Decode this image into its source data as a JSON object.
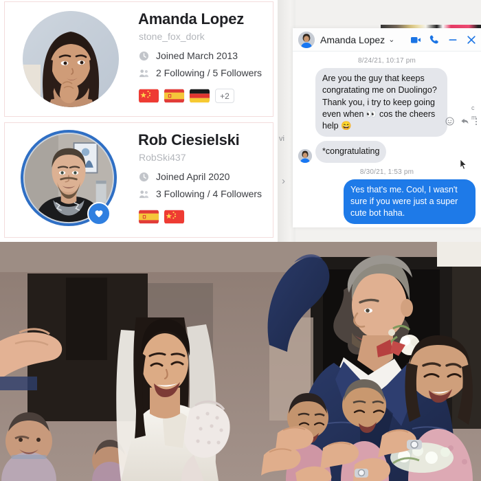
{
  "profiles": {
    "cards": [
      {
        "name": "Amanda Lopez",
        "handle": "stone_fox_dork",
        "joined": "Joined March 2013",
        "follows": "2 Following / 5 Followers",
        "flags": [
          "china",
          "spain",
          "germany"
        ],
        "more_flags": "+2",
        "has_heart_badge": false,
        "avatar_ring": false
      },
      {
        "name": "Rob Ciesielski",
        "handle": "RobSki437",
        "joined": "Joined April 2020",
        "follows": "3 Following / 4 Followers",
        "flags": [
          "spain",
          "china"
        ],
        "more_flags": "",
        "has_heart_badge": true,
        "avatar_ring": true
      }
    ],
    "icons": {
      "clock": "clock-icon",
      "people": "people-icon",
      "heart": "heart-icon"
    },
    "colors": {
      "card_border": "#f3dcdc",
      "name": "#1f2024",
      "handle": "#b3b6bb",
      "meta": "#3b3d42",
      "ring": "#2f6fc4",
      "badge": "#2f7fe0"
    }
  },
  "chat": {
    "header": {
      "title": "Amanda Lopez",
      "caret": "⌄",
      "actions": [
        "video-call-icon",
        "voice-call-icon",
        "minimize-icon",
        "close-icon"
      ],
      "accent": "#1b74e4"
    },
    "messages": [
      {
        "kind": "timestamp",
        "text": "8/24/21, 10:17 pm"
      },
      {
        "kind": "incoming",
        "text": "Are you the guy that keeps congratating me on Duolingo? Thank you, i try to keep going even when 👀 cos the cheers help 😄",
        "has_avatar": false
      },
      {
        "kind": "incoming",
        "text": "*congratulating",
        "has_avatar": true
      },
      {
        "kind": "timestamp",
        "text": "8/30/21, 1:53 pm"
      },
      {
        "kind": "outgoing",
        "text": "Yes that's me. Cool, I wasn't sure if you were just a super cute bot haha."
      }
    ],
    "reactions": [
      "emoji-react-icon",
      "reply-icon",
      "more-options-icon"
    ],
    "background_text": "vi",
    "background_chevron": "›",
    "edge_text": "c\nm",
    "colors": {
      "incoming_bubble": "#e4e6eb",
      "outgoing_bubble": "#1e7ae8",
      "incoming_text": "#141414",
      "outgoing_text": "#ffffff",
      "timestamp": "#9a9ca1"
    }
  },
  "photo": {
    "caption": "Wedding photo: bride in white gown with veil and lace glove beside groom in navy suit with white boutonniere, raising his arm; guests in pink clapping",
    "colors": {
      "wall": "#8d7b72",
      "doorway": "#2a2420",
      "suit": "#23315c",
      "dress": "#f2efe9",
      "guests": "#d69aa3"
    }
  }
}
